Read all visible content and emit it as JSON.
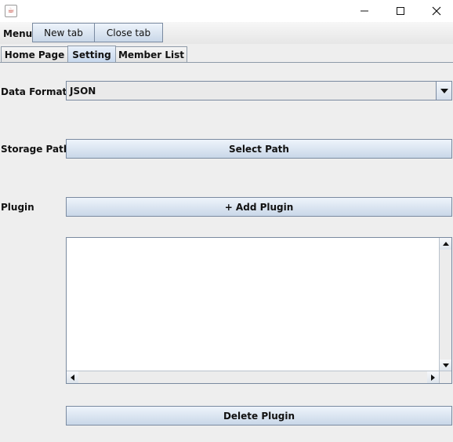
{
  "window": {
    "icon": "java-cup-icon",
    "controls": [
      "minimize-icon",
      "maximize-icon",
      "close-icon"
    ]
  },
  "menubar": {
    "menu_label": "Menu",
    "new_tab": "New tab",
    "close_tab": "Close tab"
  },
  "tabs": [
    {
      "label": "Home Page",
      "active": false
    },
    {
      "label": "Setting",
      "active": true
    },
    {
      "label": "Member List",
      "active": false
    }
  ],
  "settings": {
    "data_format_label": "Data Format",
    "data_format_value": "JSON",
    "storage_path_label": "Storage Path",
    "select_path_button": "Select Path",
    "plugin_label": "Plugin",
    "add_plugin_button": "+ Add Plugin",
    "plugin_list": [],
    "delete_plugin_button": "Delete Plugin"
  }
}
